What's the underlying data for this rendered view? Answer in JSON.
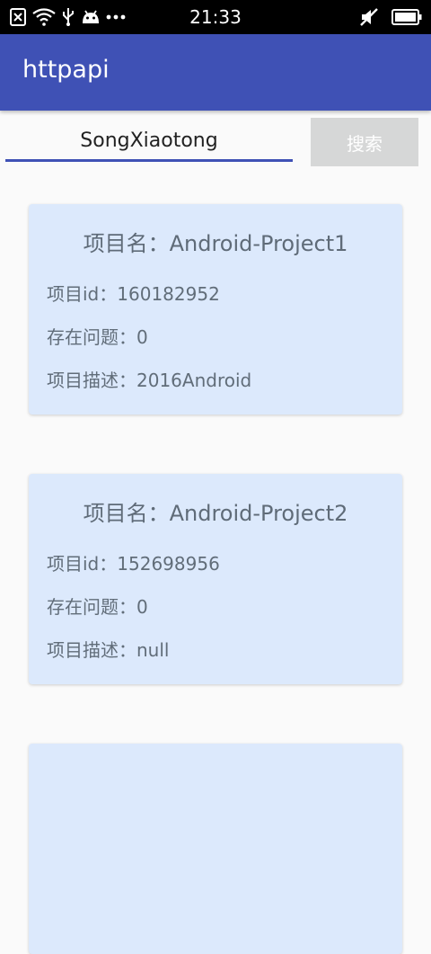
{
  "status_bar": {
    "time": "21:33",
    "left_icons": [
      "notification-x-icon",
      "wifi-icon",
      "usb-icon",
      "android-icon",
      "more-dots-icon"
    ],
    "right_icons": [
      "mute-icon",
      "battery-icon"
    ]
  },
  "app_bar": {
    "title": "httpapi",
    "color": "#3f51b5"
  },
  "search": {
    "value": "SongXiaotong",
    "button_label": "搜索"
  },
  "projects": [
    {
      "name_label": "项目名：",
      "name": "Android-Project1",
      "id_label": "项目id：",
      "id": "160182952",
      "issues_label": "存在问题：",
      "issues": "0",
      "desc_label": "项目描述：",
      "desc": "2016Android"
    },
    {
      "name_label": "项目名：",
      "name": "Android-Project2",
      "id_label": "项目id：",
      "id": "152698956",
      "issues_label": "存在问题：",
      "issues": "0",
      "desc_label": "项目描述：",
      "desc": "null"
    }
  ]
}
